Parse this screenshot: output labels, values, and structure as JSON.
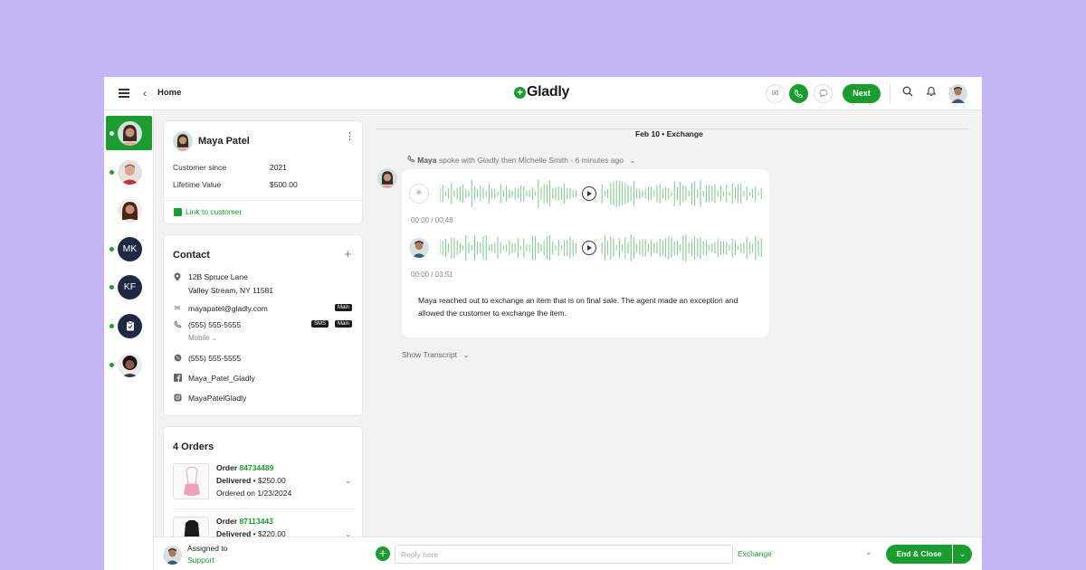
{
  "topbar": {
    "home_label": "Home",
    "logo_text": "Gladly",
    "next_label": "Next"
  },
  "rail": {
    "initials_1": "MK",
    "initials_2": "KF"
  },
  "customer": {
    "name": "Maya Patel",
    "since_label": "Customer since",
    "since_value": "2021",
    "ltv_label": "Lifetime Value",
    "ltv_value": "$500.00",
    "link_label": "Link to customer"
  },
  "contact": {
    "title": "Contact",
    "address_line1": "12B Spruce Lane",
    "address_line2": "Valley Stream, NY 11581",
    "email": "mayapatel@gladly.com",
    "email_tag": "Main",
    "phone": "(555) 555-5555",
    "phone_tag_sms": "SMS",
    "phone_tag_main": "Main",
    "phone_type": "Mobile",
    "whatsapp": "(555) 555-5555",
    "facebook": "Maya_Patel_Gladly",
    "instagram": "MayaPatelGladly"
  },
  "orders": {
    "title": "4 Orders",
    "items": [
      {
        "label": "Order",
        "number": "84734489",
        "status": "Delivered",
        "price": "$250.00",
        "ordered": "Ordered on 1/23/2024"
      },
      {
        "label": "Order",
        "number": "87113443",
        "status": "Delivered",
        "price": "$220.00"
      }
    ]
  },
  "conversation": {
    "date": "Feb 10",
    "topic": "Exchange",
    "speaker": "Maya",
    "meta": "spoke with Gladly then Michelle Smith - 6 minutes ago",
    "call1_time": "00:00 / 00:48",
    "call2_time": "00:00 / 03:51",
    "summary": "Maya reached out to exchange an item that is on final sale. The agent made an exception and allowed the customer to exchange the item.",
    "show_transcript": "Show Transcript"
  },
  "bottombar": {
    "assigned_label": "Assigned to",
    "assigned_value": "Support",
    "reply_placeholder": "Reply here",
    "topic_value": "Exchange",
    "end_close_label": "End & Close"
  },
  "colors": {
    "brand_green": "#1a9d2e",
    "background": "#c6b6f7",
    "navy": "#1e2a44"
  }
}
